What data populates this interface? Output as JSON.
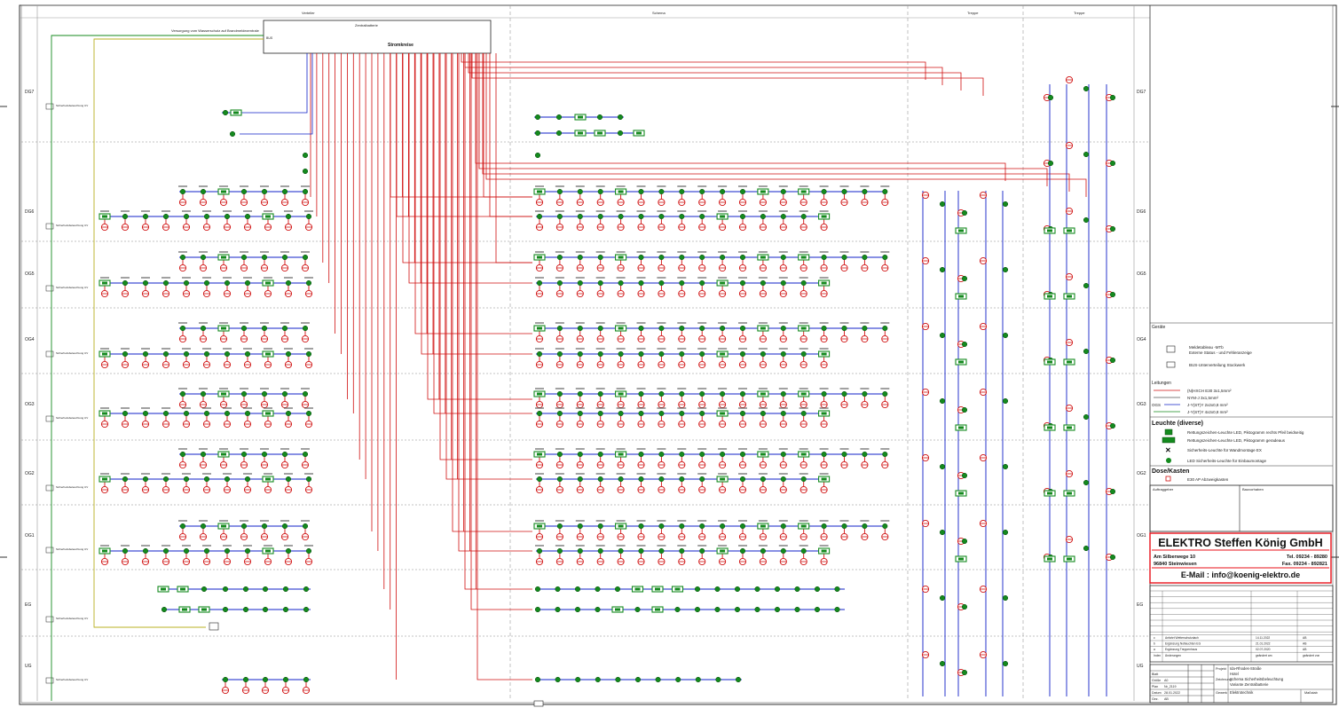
{
  "header": {
    "zone1": "Verteiler",
    "zone2": "Schema",
    "zone3": "Treppe",
    "zone4": "Treppe"
  },
  "central_battery": {
    "title": "Stromkreise",
    "subtitle": "Zentralbatterie",
    "input1": "Einspeisung vom Niederspannungs-Hauptverteiler",
    "input2": "Versorgung vom Wasserschutz auf Brandmeldezentrale",
    "input3": "BUS"
  },
  "floors": [
    "DG7",
    "DG6",
    "OG5",
    "OG4",
    "OG3",
    "OG2",
    "OG1",
    "EG",
    "UG"
  ],
  "sub_distribution_label": "Sicherheitsbeleuchtung UV",
  "legend": {
    "section_devices": "Geräte",
    "device1_a": "Meldetableau -MTb",
    "device1_b": "Externe Status - und Fehleranzeige",
    "device2": "BUS-Unterverteilung Stockwerk",
    "section_cables": "Leitungen",
    "cable1": "(N)HXCH E30 3x1,5mm²",
    "cable2": "NYM-J 3x1,5mm²",
    "cable3": "J-Y(ST)Y 2x2x0,8 mm²",
    "cable4": "J-Y(ST)Y 4x2x0,8 mm²",
    "cable3_tag": "OGS",
    "section_luminaires": "Leuchte (diverse)",
    "lum1": "Rettungszeichen-Leuchte LED, Piktogramm rechts Pfeil beidseitig",
    "lum2": "Rettungszeichen-Leuchte LED, Piktogramm geradeaus",
    "lum3": "Sicherheits-Leuchte für Wandmontage EX",
    "lum4": "LED Sicherheits-Leuchte für Einbaumontage",
    "section_boxes": "Dose/Kasten",
    "box1": "E30 AP Abzweigkasten"
  },
  "client_box": {
    "label_left": "Auftraggeber",
    "label_right": "Bauvorhaben"
  },
  "company": {
    "name": "ELEKTRO Steffen König GmbH",
    "street": "Am Silberwege 10",
    "city": "96840 Steinwiesen",
    "tel": "Tel. 09234 - 89280",
    "fax": "Fax. 09234 - 892821",
    "email": "E-Mail :  info@koenig-elektro.de"
  },
  "revisions": [
    {
      "idx": "c",
      "text": "Anfahrt Wetterschutzdach",
      "date": "14.11.2022",
      "by": "AB"
    },
    {
      "idx": "b",
      "text": "Ergänzung Notleuchten EG",
      "date": "21.01.2022",
      "by": "AB"
    },
    {
      "idx": "a",
      "text": "Ergänzung Treppenhaus",
      "date": "02.07.2020",
      "by": "AB"
    },
    {
      "idx": "Index",
      "text": "Änderungen",
      "date": "geändert am",
      "by": "geändert von"
    }
  ],
  "title_block": {
    "blatt_label": "Blatt",
    "blatt": "1",
    "groesse_label": "Größe",
    "groesse": "A0",
    "plan_label": "Plan",
    "plan": "Nr_2119",
    "datum_label": "Datum",
    "datum": "28.01.2022",
    "gez_label": "Gez.",
    "gez": "AB",
    "project_label": "Projekt",
    "project1": "Ida-Rhodes-Straße",
    "project2": "Hotel",
    "plan_title_label": "Zeichnung",
    "plan_title1": "Schema Sicherheitsbeleuchtung",
    "plan_title2": "Variante Zentralbatterie",
    "gewerk_label": "Gewerk",
    "gewerk": "Elektrotechnik",
    "massstab_label": "Maßstab"
  },
  "colors": {
    "red_line": "#d01010",
    "blue_line": "#1020c8",
    "green_fill": "#148a1e",
    "grey_grid": "#888888",
    "company_red": "#e8101a"
  }
}
